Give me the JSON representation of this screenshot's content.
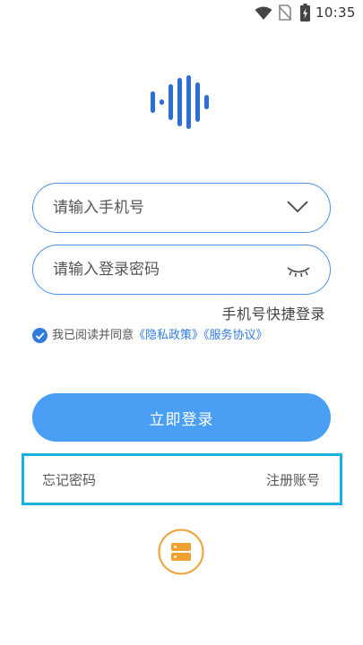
{
  "status_bar": {
    "time": "10:35",
    "icons": [
      "wifi-icon",
      "no-sim-icon",
      "battery-charging-icon"
    ]
  },
  "login": {
    "phone_placeholder": "请输入手机号",
    "password_placeholder": "请输入登录密码",
    "quick_login": "手机号快捷登录",
    "agreement_prefix": "我已阅读并同意",
    "privacy_link": "《隐私政策》",
    "service_link": "《服务协议》",
    "login_button": "立即登录",
    "forgot_password": "忘记密码",
    "register": "注册账号"
  },
  "colors": {
    "primary": "#4a9ff5",
    "field_border": "#4a90e2",
    "link": "#2f7be0",
    "highlight_box": "#1ab0e0",
    "server_icon": "#f0a030"
  }
}
